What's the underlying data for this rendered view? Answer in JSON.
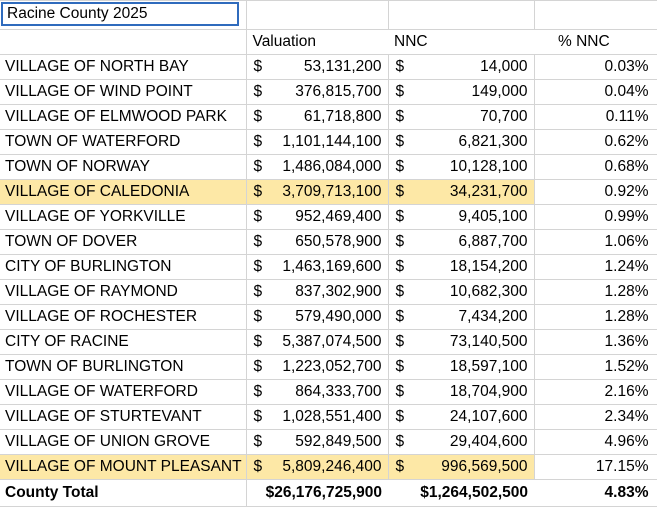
{
  "title_cell": "Racine County 2025",
  "headers": {
    "valuation": "Valuation",
    "nnc": "NNC",
    "pct_nnc": "% NNC"
  },
  "currency_symbol": "$",
  "rows": [
    {
      "name": "VILLAGE OF NORTH BAY",
      "valuation": "53,131,200",
      "nnc": "14,000",
      "pct": "0.03%",
      "highlight": false
    },
    {
      "name": "VILLAGE OF WIND POINT",
      "valuation": "376,815,700",
      "nnc": "149,000",
      "pct": "0.04%",
      "highlight": false
    },
    {
      "name": "VILLAGE OF ELMWOOD PARK",
      "valuation": "61,718,800",
      "nnc": "70,700",
      "pct": "0.11%",
      "highlight": false
    },
    {
      "name": "TOWN OF WATERFORD",
      "valuation": "1,101,144,100",
      "nnc": "6,821,300",
      "pct": "0.62%",
      "highlight": false
    },
    {
      "name": "TOWN OF NORWAY",
      "valuation": "1,486,084,000",
      "nnc": "10,128,100",
      "pct": "0.68%",
      "highlight": false
    },
    {
      "name": "VILLAGE OF CALEDONIA",
      "valuation": "3,709,713,100",
      "nnc": "34,231,700",
      "pct": "0.92%",
      "highlight": true
    },
    {
      "name": "VILLAGE OF YORKVILLE",
      "valuation": "952,469,400",
      "nnc": "9,405,100",
      "pct": "0.99%",
      "highlight": false
    },
    {
      "name": "TOWN OF DOVER",
      "valuation": "650,578,900",
      "nnc": "6,887,700",
      "pct": "1.06%",
      "highlight": false
    },
    {
      "name": "CITY OF BURLINGTON",
      "valuation": "1,463,169,600",
      "nnc": "18,154,200",
      "pct": "1.24%",
      "highlight": false
    },
    {
      "name": "VILLAGE OF RAYMOND",
      "valuation": "837,302,900",
      "nnc": "10,682,300",
      "pct": "1.28%",
      "highlight": false
    },
    {
      "name": "VILLAGE OF ROCHESTER",
      "valuation": "579,490,000",
      "nnc": "7,434,200",
      "pct": "1.28%",
      "highlight": false
    },
    {
      "name": "CITY OF RACINE",
      "valuation": "5,387,074,500",
      "nnc": "73,140,500",
      "pct": "1.36%",
      "highlight": false
    },
    {
      "name": "TOWN OF BURLINGTON",
      "valuation": "1,223,052,700",
      "nnc": "18,597,100",
      "pct": "1.52%",
      "highlight": false
    },
    {
      "name": "VILLAGE OF WATERFORD",
      "valuation": "864,333,700",
      "nnc": "18,704,900",
      "pct": "2.16%",
      "highlight": false
    },
    {
      "name": "VILLAGE OF STURTEVANT",
      "valuation": "1,028,551,400",
      "nnc": "24,107,600",
      "pct": "2.34%",
      "highlight": false
    },
    {
      "name": "VILLAGE OF UNION GROVE",
      "valuation": "592,849,500",
      "nnc": "29,404,600",
      "pct": "4.96%",
      "highlight": false
    },
    {
      "name": "VILLAGE OF MOUNT PLEASANT",
      "valuation": "5,809,246,400",
      "nnc": "996,569,500",
      "pct": "17.15%",
      "highlight": true
    }
  ],
  "total": {
    "name": "County Total",
    "valuation": "$26,176,725,900",
    "nnc": "$1,264,502,500",
    "pct": "4.83%"
  },
  "colors": {
    "highlight": "#fde8a6",
    "selection_border": "#2f6bbd",
    "gridline": "#d4d4d4"
  }
}
